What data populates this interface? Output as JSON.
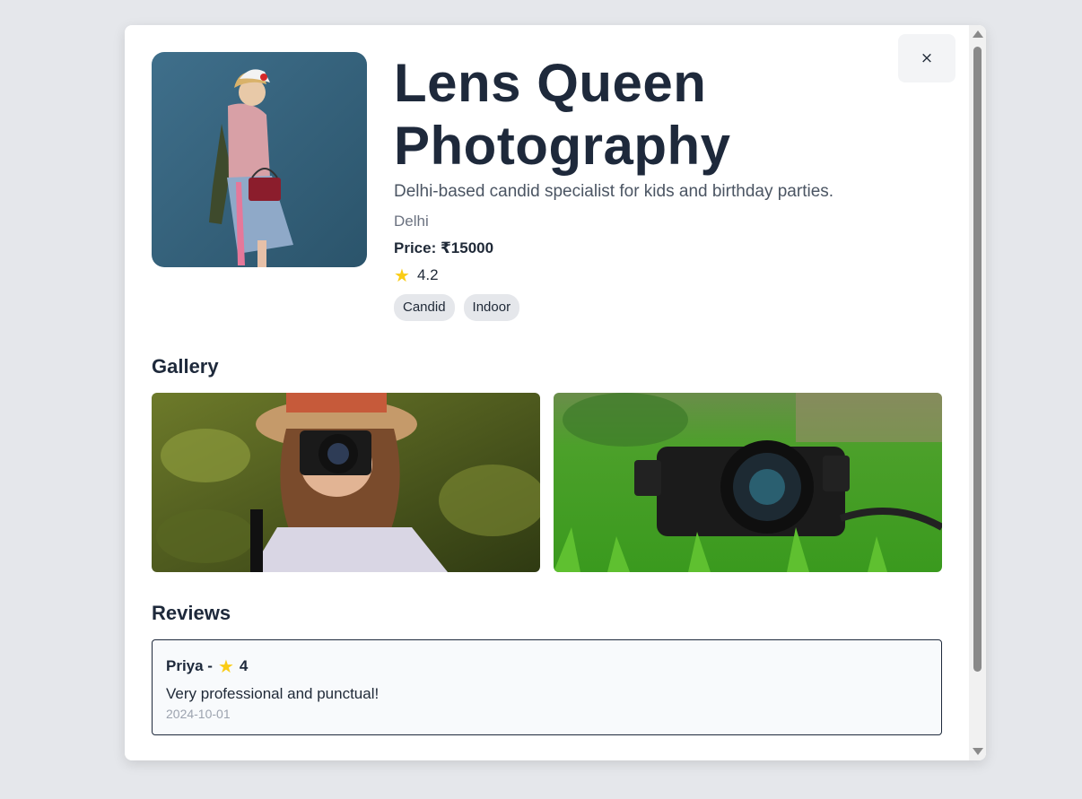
{
  "modal": {
    "close_label": "×",
    "profile": {
      "name": "Lens Queen Photography",
      "description": "Delhi-based candid specialist for kids and birthday parties.",
      "city": "Delhi",
      "price": "Price: ₹15000",
      "rating": "4.2",
      "tags": [
        "Candid",
        "Indoor"
      ]
    },
    "gallery": {
      "title": "Gallery"
    },
    "reviews": {
      "title": "Reviews",
      "items": [
        {
          "author": "Priya -",
          "rating": "4",
          "text": "Very professional and punctual!",
          "date": "2024-10-01"
        }
      ]
    }
  },
  "icons": {
    "star": "star-icon",
    "close": "close-icon"
  },
  "colors": {
    "title": "#1e293b",
    "star": "#facc15",
    "tag_bg": "#e5e7eb",
    "page_bg": "#e5e7eb"
  }
}
